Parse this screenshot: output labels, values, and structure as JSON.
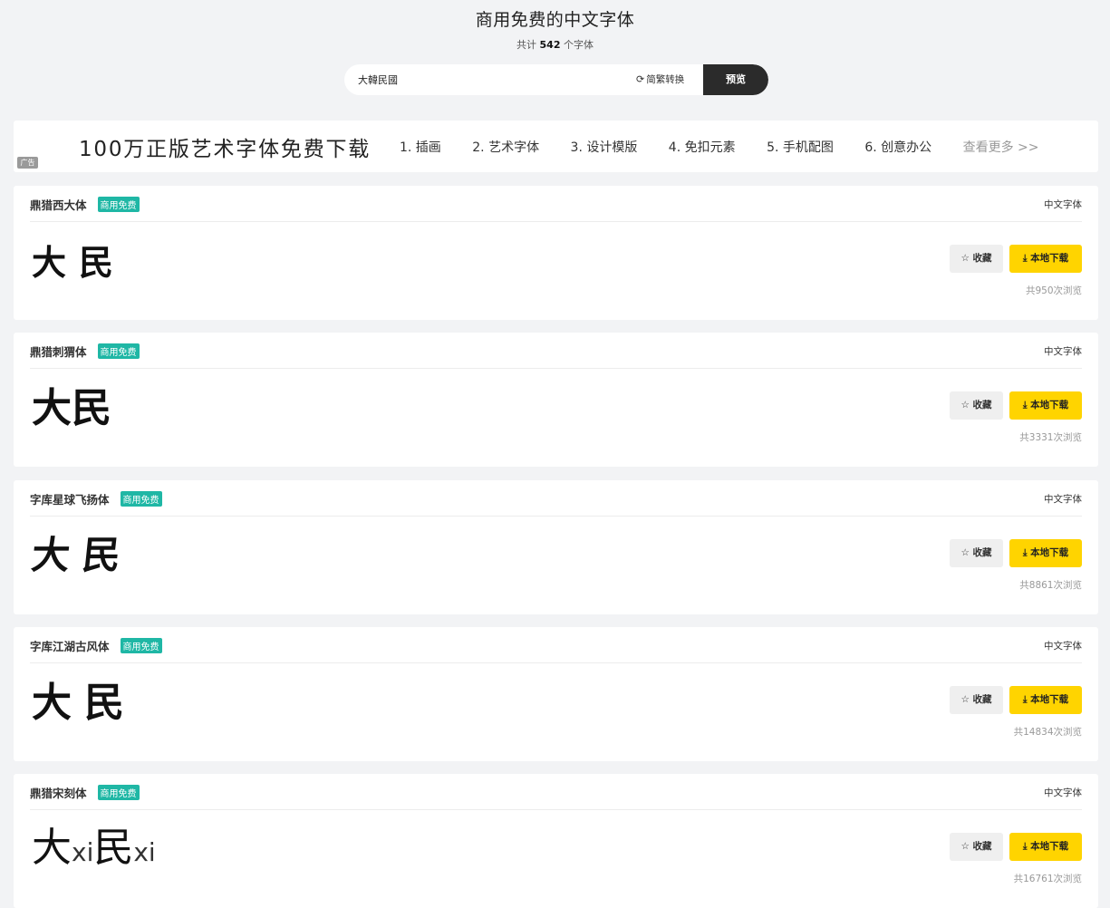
{
  "header": {
    "title": "商用免费的中文字体",
    "count_prefix": "共计",
    "count": "542",
    "count_suffix": "个字体"
  },
  "search": {
    "value": "大韓民國",
    "convert_label": "简繁转换",
    "preview_label": "预览"
  },
  "ad": {
    "slogan": "100万正版艺术字体免费下载",
    "links": [
      "1. 插画",
      "2. 艺术字体",
      "3. 设计模版",
      "4. 免扣元素",
      "5. 手机配图",
      "6. 创意办公"
    ],
    "more_label": "查看更多 >>",
    "badge": "广告"
  },
  "cards": [
    {
      "name": "鼎猎西大体",
      "badge": "商用免费",
      "category": "中文字体",
      "sample": "大民",
      "fav_label": "收藏",
      "download_label": "本地下载",
      "views": "共950次浏览"
    },
    {
      "name": "鼎猎刺猬体",
      "badge": "商用免费",
      "category": "中文字体",
      "sample": "大民",
      "fav_label": "收藏",
      "download_label": "本地下载",
      "views": "共3331次浏览"
    },
    {
      "name": "字库星球飞扬体",
      "badge": "商用免费",
      "category": "中文字体",
      "sample": "大民",
      "fav_label": "收藏",
      "download_label": "本地下载",
      "views": "共8861次浏览"
    },
    {
      "name": "字库江湖古风体",
      "badge": "商用免费",
      "category": "中文字体",
      "sample": "大民",
      "fav_label": "收藏",
      "download_label": "本地下载",
      "views": "共14834次浏览"
    },
    {
      "name": "鼎猎宋刻体",
      "badge": "商用免费",
      "category": "中文字体",
      "sample_parts": [
        "大",
        "xi",
        "民",
        "xi"
      ],
      "fav_label": "收藏",
      "download_label": "本地下载",
      "views": "共16761次浏览"
    }
  ],
  "icons": {
    "refresh": "refresh-icon",
    "star": "star-icon",
    "download": "download-icon"
  }
}
